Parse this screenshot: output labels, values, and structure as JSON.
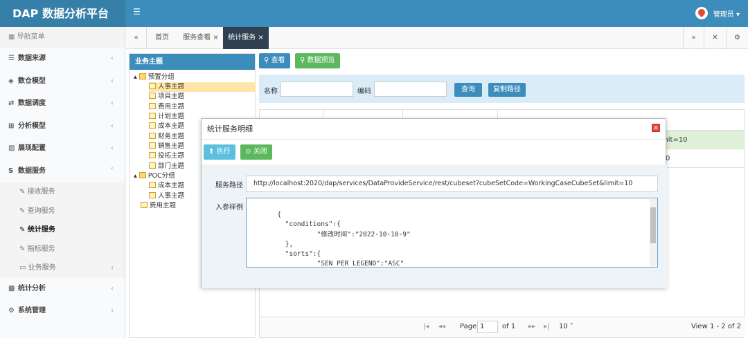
{
  "app": {
    "title": "DAP 数据分析平台",
    "user": "管理员 ▾"
  },
  "sidebar": {
    "header": "导航菜单",
    "items": [
      {
        "label": "数据来源",
        "icon": "database-icon"
      },
      {
        "label": "数仓模型",
        "icon": "cubes-icon"
      },
      {
        "label": "数据调度",
        "icon": "shuffle-icon"
      },
      {
        "label": "分析模型",
        "icon": "sitemap-icon"
      },
      {
        "label": "展现配置",
        "icon": "film-icon"
      },
      {
        "label": "数据服务",
        "icon": "s-icon"
      }
    ],
    "subitems": [
      "接收服务",
      "查询服务",
      "统计服务",
      "指标服务",
      "业务服务"
    ],
    "items2": [
      {
        "label": "统计分析"
      },
      {
        "label": "系统管理"
      }
    ]
  },
  "tabs": {
    "items": [
      "首页",
      "服务查看",
      "统计服务"
    ]
  },
  "tree": {
    "title": "业务主题",
    "g1": "预置分组",
    "g1items": [
      "人事主题",
      "项目主题",
      "费用主题",
      "计划主题",
      "成本主题",
      "财务主题",
      "销售主题",
      "投拓主题",
      "部门主题"
    ],
    "g2": "POC分组",
    "g2items": [
      "成本主题",
      "人事主题"
    ],
    "leaf": "费用主题"
  },
  "toolbar": {
    "view": "查看",
    "preview": "数据预览"
  },
  "search": {
    "name_label": "名称",
    "code_label": "编码",
    "query": "查询",
    "copy_path": "复制路径"
  },
  "grid": {
    "r1": "mit=10",
    "r2": "0"
  },
  "pager": {
    "page_label": "Page",
    "page_value": "1",
    "of": "of 1",
    "size": "10",
    "view": "View 1 - 2 of 2"
  },
  "modal": {
    "title": "统计服务明细",
    "exec": "执行",
    "close": "关闭",
    "path_label": "服务路径",
    "path_value": "http://localhost:2020/dap/services/DataProvideService/rest/cubeset?cubeSetCode=WorkingCaseCubeSet&limit=10",
    "param_label": "入参样例",
    "param_value": "{\n        \"conditions\":{\n                \"修改时间\":\"2022-10-10-9\"\n        },\n        \"sorts\":{\n                \"SEN_PER_LEGEND\":\"ASC\"\n        }"
  }
}
